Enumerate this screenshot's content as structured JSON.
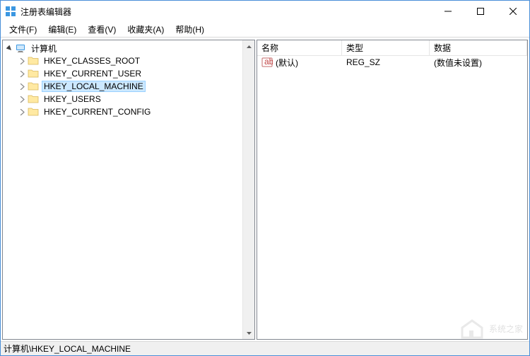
{
  "window": {
    "title": "注册表编辑器"
  },
  "menu": {
    "file": "文件(F)",
    "edit": "编辑(E)",
    "view": "查看(V)",
    "favorites": "收藏夹(A)",
    "help": "帮助(H)"
  },
  "tree": {
    "root": "计算机",
    "nodes": [
      "HKEY_CLASSES_ROOT",
      "HKEY_CURRENT_USER",
      "HKEY_LOCAL_MACHINE",
      "HKEY_USERS",
      "HKEY_CURRENT_CONFIG"
    ],
    "selected_index": 2
  },
  "list": {
    "columns": {
      "name": "名称",
      "type": "类型",
      "data": "数据"
    },
    "rows": [
      {
        "name": "(默认)",
        "type": "REG_SZ",
        "data": "(数值未设置)"
      }
    ]
  },
  "statusbar": {
    "path": "计算机\\HKEY_LOCAL_MACHINE"
  },
  "watermark": "系统之家"
}
